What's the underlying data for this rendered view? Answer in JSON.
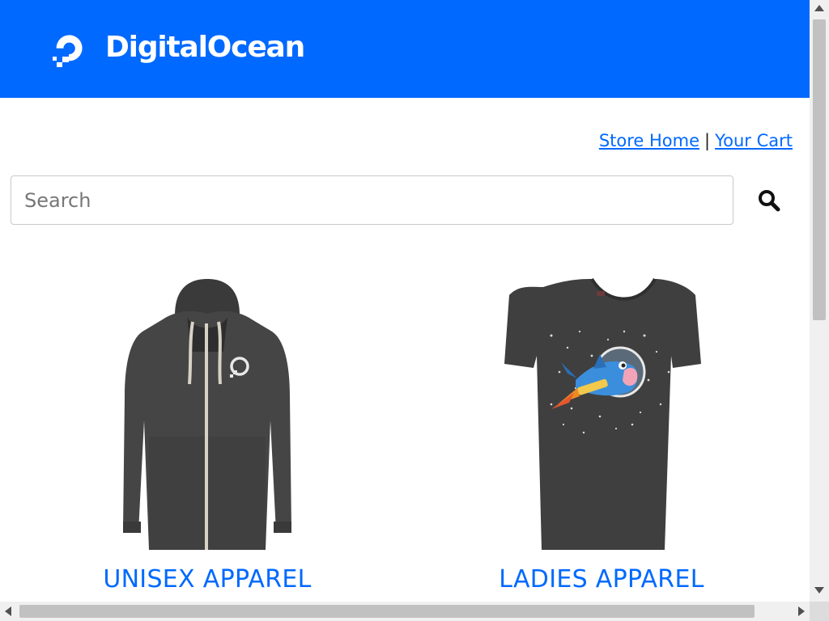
{
  "header": {
    "logo_text": "DigitalOcean",
    "logo_icon": "digitalocean-logo-icon",
    "brand_color": "#0069ff"
  },
  "nav": {
    "store_home": "Store Home",
    "separator": "|",
    "your_cart": "Your Cart"
  },
  "search": {
    "placeholder": "Search",
    "value": "",
    "button_icon": "search-icon"
  },
  "products": [
    {
      "title": "UNISEX APPAREL",
      "image": "gray-zip-hoodie"
    },
    {
      "title": "LADIES APPAREL",
      "image": "gray-shark-rocket-tshirt"
    }
  ],
  "colors": {
    "link": "#0069ff",
    "header_bg": "#0069ff"
  }
}
